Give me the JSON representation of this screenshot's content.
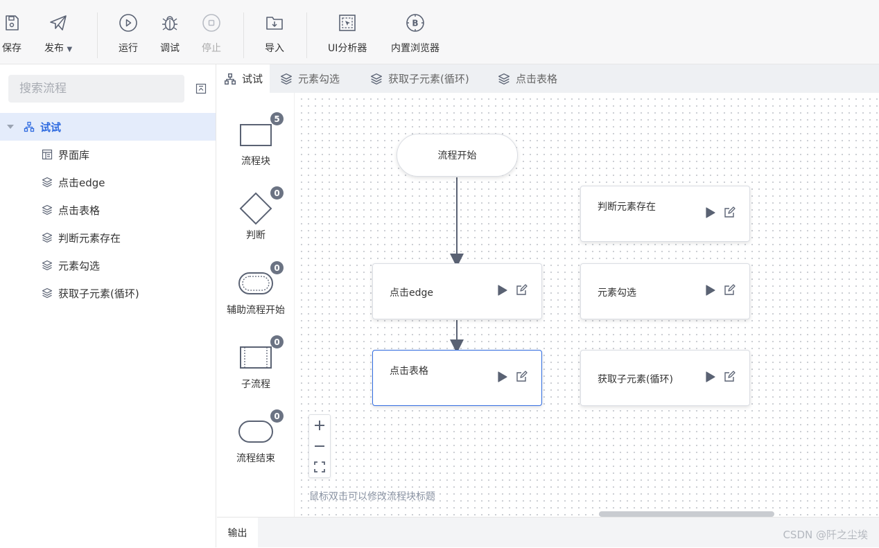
{
  "toolbar": {
    "save": "保存",
    "publish": "发布",
    "run": "运行",
    "debug": "调试",
    "stop": "停止",
    "import": "导入",
    "ui_analyzer": "UI分析器",
    "browser": "内置浏览器"
  },
  "sidebar": {
    "search_placeholder": "搜索流程",
    "root": "试试",
    "items": [
      {
        "label": "界面库",
        "icon": "layout-icon"
      },
      {
        "label": "点击edge",
        "icon": "layers-icon"
      },
      {
        "label": "点击表格",
        "icon": "layers-icon"
      },
      {
        "label": "判断元素存在",
        "icon": "layers-icon"
      },
      {
        "label": "元素勾选",
        "icon": "layers-icon"
      },
      {
        "label": "获取子元素(循环)",
        "icon": "layers-icon"
      }
    ]
  },
  "tabs": [
    "试试",
    "元素勾选",
    "获取子元素(循环)",
    "点击表格"
  ],
  "palette": [
    {
      "label": "流程块",
      "count": "5"
    },
    {
      "label": "判断",
      "count": "0"
    },
    {
      "label": "辅助流程开始",
      "count": "0"
    },
    {
      "label": "子流程",
      "count": "0"
    },
    {
      "label": "流程结束",
      "count": "0"
    }
  ],
  "canvas": {
    "start": "流程开始",
    "nodes": [
      "点击edge",
      "点击表格",
      "判断元素存在",
      "元素勾选",
      "获取子元素(循环)"
    ],
    "hint": "鼠标双击可以修改流程块标题"
  },
  "bottom": {
    "output_tab": "输出",
    "watermark": "CSDN @阡之尘埃"
  },
  "colors": {
    "accent": "#2f6be0",
    "icon": "#5a6273",
    "badge": "#6b7383"
  }
}
